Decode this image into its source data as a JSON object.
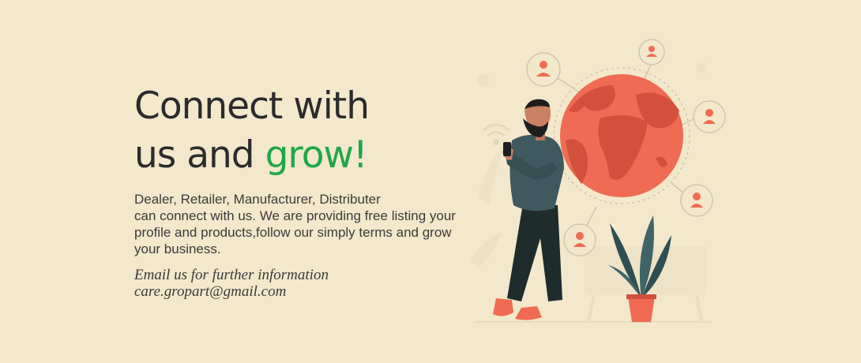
{
  "headline": {
    "line1": "Connect with",
    "line2_plain": "us and ",
    "line2_accent": "grow!"
  },
  "description": {
    "line1": "Dealer, Retailer, Manufacturer, Distributer",
    "line2": "can connect with us. We are providing free listing your",
    "line3": "profile and products,follow our simply terms and grow",
    "line4": "your business."
  },
  "contact": {
    "prompt": "Email us for further information",
    "email": "care.gropart@gmail.com"
  },
  "illustration": {
    "icons": [
      "globe-icon",
      "user-icon",
      "smartphone-icon",
      "wifi-icon",
      "plant-icon"
    ],
    "colors": {
      "globe": "#ef6b54",
      "accent_green": "#1fa64a",
      "shirt": "#3e5a5e"
    }
  }
}
